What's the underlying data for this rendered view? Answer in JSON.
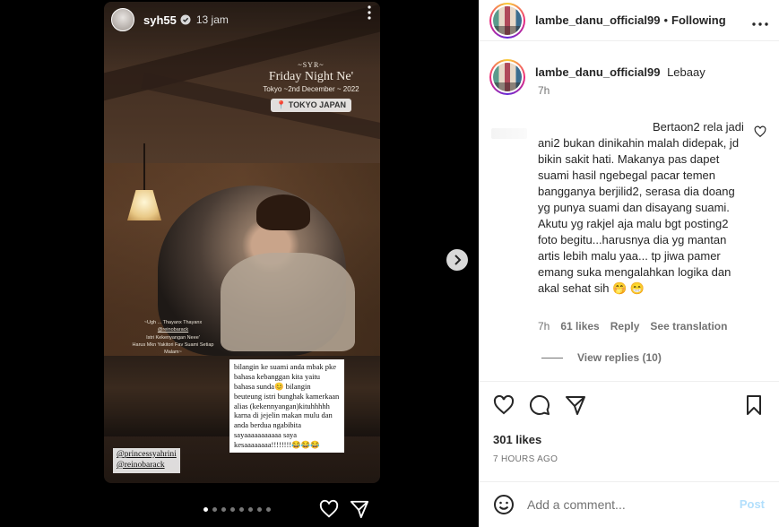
{
  "story": {
    "username": "syh55",
    "time": "13 jam",
    "overlay": {
      "small": "~SYR~",
      "title": "Friday Night Ne'",
      "date": "Tokyo ~2nd December ~ 2022",
      "location": "TOKYO JAPAN"
    },
    "caption_left": [
      "~Ugh ... Thayanx Thayanx",
      "@reinobarack",
      "Istri Kekenyangan Neee'",
      "Harus Mkn Yakitori Fav Suami Setiap",
      "Malam~"
    ],
    "textbox": "bilangin ke suami anda mbak pke bahasa kebanggan kita yaitu bahasa sunda😊 bilangin beuteung istri bunghak kamerkaan alias (kekennyangan)kituhhhhh karna di jejelin makan mulu dan anda berdua ngabibita sayaaaaaaaaaaa saya kesaaaaaaaa!!!!!!!!😂😂😂",
    "tags": [
      "@princessyahrini",
      "@reinobarack"
    ],
    "dots_total": 8,
    "dots_active": 0
  },
  "post": {
    "header": {
      "username": "lambe_danu_official99",
      "separator": "•",
      "following": "Following"
    },
    "caption": {
      "username": "lambe_danu_official99",
      "text": "Lebaay",
      "time": "7h"
    },
    "comment": {
      "text": "Bertaon2 rela jadi ani2 bukan dinikahin malah didepak, jd bikin sakit hati. Makanya pas dapet suami hasil ngebegal pacar temen bangganya berjilid2, serasa dia doang yg punya suami dan disayang suami. Akutu yg rakjel aja malu bgt posting2 foto begitu...harusnya dia yg mantan artis lebih malu yaa... tp jiwa pamer emang suka mengalahkan logika dan akal sehat sih 🤭 😁",
      "time": "7h",
      "likes": "61 likes",
      "reply": "Reply",
      "see_translation": "See translation",
      "view_replies": "View replies (10)"
    },
    "likes": "301 likes",
    "posted": "7 HOURS AGO",
    "add_comment_placeholder": "Add a comment...",
    "post_label": "Post"
  },
  "colors": {
    "post_button": "#b2dffc",
    "muted": "#737373",
    "text": "#262626"
  }
}
